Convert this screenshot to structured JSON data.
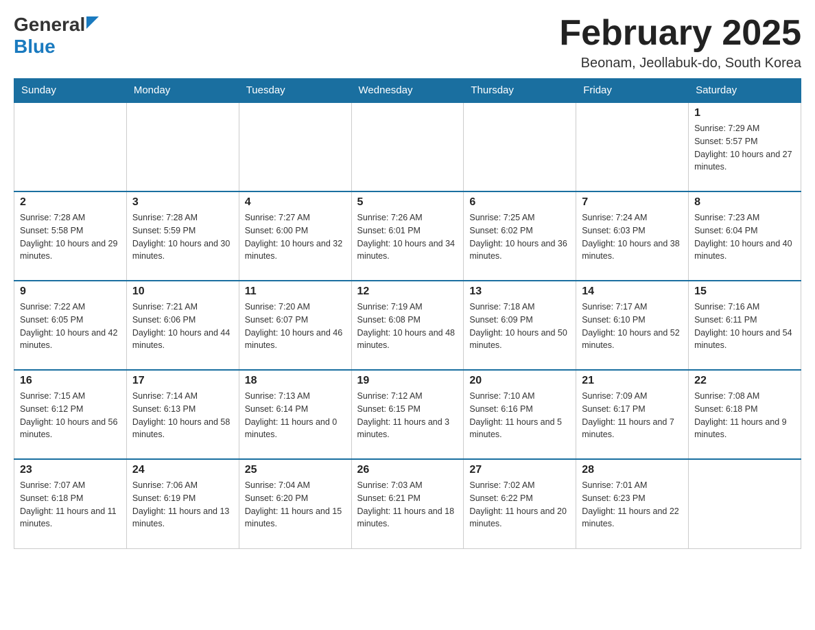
{
  "logo": {
    "general": "General",
    "blue": "Blue"
  },
  "header": {
    "month": "February 2025",
    "location": "Beonam, Jeollabuk-do, South Korea"
  },
  "weekdays": [
    "Sunday",
    "Monday",
    "Tuesday",
    "Wednesday",
    "Thursday",
    "Friday",
    "Saturday"
  ],
  "weeks": [
    {
      "days": [
        {
          "num": "",
          "info": ""
        },
        {
          "num": "",
          "info": ""
        },
        {
          "num": "",
          "info": ""
        },
        {
          "num": "",
          "info": ""
        },
        {
          "num": "",
          "info": ""
        },
        {
          "num": "",
          "info": ""
        },
        {
          "num": "1",
          "info": "Sunrise: 7:29 AM\nSunset: 5:57 PM\nDaylight: 10 hours and 27 minutes."
        }
      ]
    },
    {
      "days": [
        {
          "num": "2",
          "info": "Sunrise: 7:28 AM\nSunset: 5:58 PM\nDaylight: 10 hours and 29 minutes."
        },
        {
          "num": "3",
          "info": "Sunrise: 7:28 AM\nSunset: 5:59 PM\nDaylight: 10 hours and 30 minutes."
        },
        {
          "num": "4",
          "info": "Sunrise: 7:27 AM\nSunset: 6:00 PM\nDaylight: 10 hours and 32 minutes."
        },
        {
          "num": "5",
          "info": "Sunrise: 7:26 AM\nSunset: 6:01 PM\nDaylight: 10 hours and 34 minutes."
        },
        {
          "num": "6",
          "info": "Sunrise: 7:25 AM\nSunset: 6:02 PM\nDaylight: 10 hours and 36 minutes."
        },
        {
          "num": "7",
          "info": "Sunrise: 7:24 AM\nSunset: 6:03 PM\nDaylight: 10 hours and 38 minutes."
        },
        {
          "num": "8",
          "info": "Sunrise: 7:23 AM\nSunset: 6:04 PM\nDaylight: 10 hours and 40 minutes."
        }
      ]
    },
    {
      "days": [
        {
          "num": "9",
          "info": "Sunrise: 7:22 AM\nSunset: 6:05 PM\nDaylight: 10 hours and 42 minutes."
        },
        {
          "num": "10",
          "info": "Sunrise: 7:21 AM\nSunset: 6:06 PM\nDaylight: 10 hours and 44 minutes."
        },
        {
          "num": "11",
          "info": "Sunrise: 7:20 AM\nSunset: 6:07 PM\nDaylight: 10 hours and 46 minutes."
        },
        {
          "num": "12",
          "info": "Sunrise: 7:19 AM\nSunset: 6:08 PM\nDaylight: 10 hours and 48 minutes."
        },
        {
          "num": "13",
          "info": "Sunrise: 7:18 AM\nSunset: 6:09 PM\nDaylight: 10 hours and 50 minutes."
        },
        {
          "num": "14",
          "info": "Sunrise: 7:17 AM\nSunset: 6:10 PM\nDaylight: 10 hours and 52 minutes."
        },
        {
          "num": "15",
          "info": "Sunrise: 7:16 AM\nSunset: 6:11 PM\nDaylight: 10 hours and 54 minutes."
        }
      ]
    },
    {
      "days": [
        {
          "num": "16",
          "info": "Sunrise: 7:15 AM\nSunset: 6:12 PM\nDaylight: 10 hours and 56 minutes."
        },
        {
          "num": "17",
          "info": "Sunrise: 7:14 AM\nSunset: 6:13 PM\nDaylight: 10 hours and 58 minutes."
        },
        {
          "num": "18",
          "info": "Sunrise: 7:13 AM\nSunset: 6:14 PM\nDaylight: 11 hours and 0 minutes."
        },
        {
          "num": "19",
          "info": "Sunrise: 7:12 AM\nSunset: 6:15 PM\nDaylight: 11 hours and 3 minutes."
        },
        {
          "num": "20",
          "info": "Sunrise: 7:10 AM\nSunset: 6:16 PM\nDaylight: 11 hours and 5 minutes."
        },
        {
          "num": "21",
          "info": "Sunrise: 7:09 AM\nSunset: 6:17 PM\nDaylight: 11 hours and 7 minutes."
        },
        {
          "num": "22",
          "info": "Sunrise: 7:08 AM\nSunset: 6:18 PM\nDaylight: 11 hours and 9 minutes."
        }
      ]
    },
    {
      "days": [
        {
          "num": "23",
          "info": "Sunrise: 7:07 AM\nSunset: 6:18 PM\nDaylight: 11 hours and 11 minutes."
        },
        {
          "num": "24",
          "info": "Sunrise: 7:06 AM\nSunset: 6:19 PM\nDaylight: 11 hours and 13 minutes."
        },
        {
          "num": "25",
          "info": "Sunrise: 7:04 AM\nSunset: 6:20 PM\nDaylight: 11 hours and 15 minutes."
        },
        {
          "num": "26",
          "info": "Sunrise: 7:03 AM\nSunset: 6:21 PM\nDaylight: 11 hours and 18 minutes."
        },
        {
          "num": "27",
          "info": "Sunrise: 7:02 AM\nSunset: 6:22 PM\nDaylight: 11 hours and 20 minutes."
        },
        {
          "num": "28",
          "info": "Sunrise: 7:01 AM\nSunset: 6:23 PM\nDaylight: 11 hours and 22 minutes."
        },
        {
          "num": "",
          "info": ""
        }
      ]
    }
  ]
}
